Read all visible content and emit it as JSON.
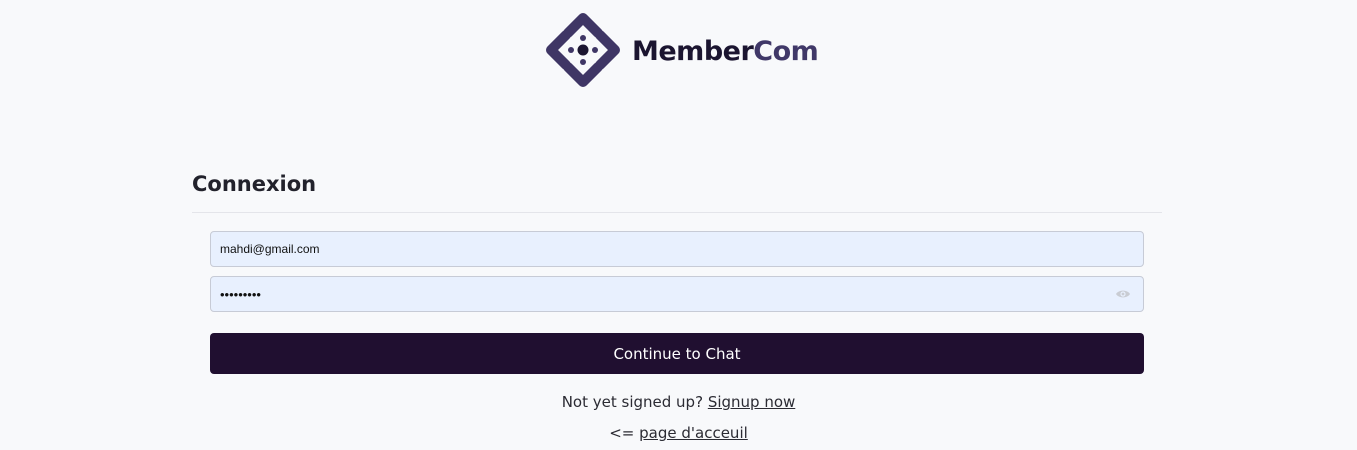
{
  "brand": {
    "name_part1": "Member",
    "name_part2": "Com",
    "logo_icon": "diamond-logo-icon",
    "colors": {
      "dark": "#1b1530",
      "accent": "#403868"
    }
  },
  "form": {
    "title": "Connexion",
    "email": {
      "value": "mahdi@gmail.com",
      "placeholder": ""
    },
    "password": {
      "value": "•••••••••",
      "placeholder": "",
      "toggle_icon": "eye-icon"
    },
    "submit_label": "Continue to Chat",
    "button_color": "#200f30"
  },
  "footer": {
    "signup_prompt": "Not yet signed up?",
    "signup_link": "Signup now",
    "back_prefix": "<=",
    "home_link": "page d'acceuil"
  }
}
